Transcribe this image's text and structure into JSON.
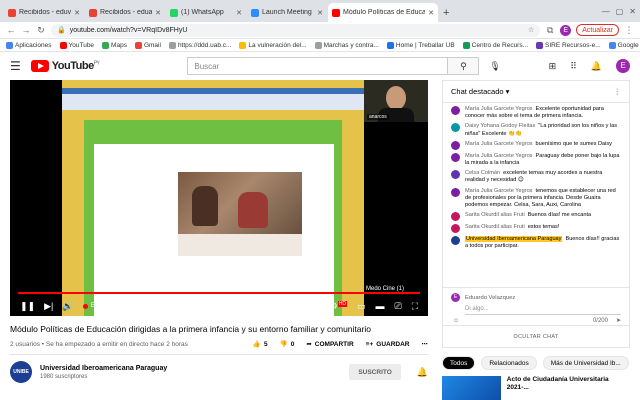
{
  "browser": {
    "tabs": [
      {
        "label": "Recibidos - eduvelrom@gmail...",
        "color": "#ea4335"
      },
      {
        "label": "Recibidos - eduardo.velazque...",
        "color": "#ea4335"
      },
      {
        "label": "(1) WhatsApp",
        "color": "#25d366"
      },
      {
        "label": "Launch Meeting - Zoom",
        "color": "#2d8cff"
      },
      {
        "label": "Módulo Políticas de Educació",
        "color": "#ff0000",
        "active": true
      }
    ],
    "url": "youtube.com/watch?v=VRqIDv8FHyU",
    "user_initial": "E",
    "update_label": "Actualizar",
    "bookmarks": [
      {
        "label": "Aplicaciones",
        "color": "#4285f4"
      },
      {
        "label": "YouTube",
        "color": "#ff0000"
      },
      {
        "label": "Maps",
        "color": "#34a853"
      },
      {
        "label": "Gmail",
        "color": "#ea4335"
      },
      {
        "label": "https://ddd.uab.c...",
        "color": "#9e9e9e"
      },
      {
        "label": "La vulneración del...",
        "color": "#fbbc05"
      },
      {
        "label": "Marchas y contra...",
        "color": "#9e9e9e"
      },
      {
        "label": "Home | Treballar UB",
        "color": "#1a73e8"
      },
      {
        "label": "Centro de Recurs...",
        "color": "#0f9d58"
      },
      {
        "label": "SIRE Recursos-e...",
        "color": "#673ab7"
      },
      {
        "label": "Google Académico",
        "color": "#4285f4"
      }
    ]
  },
  "yt": {
    "logo_text": "YouTube",
    "logo_region": "PY",
    "search_placeholder": "Buscar",
    "user_initial": "E"
  },
  "player": {
    "speaker_name": "anarcos",
    "overlay_label": "Medo Cine (1)",
    "live_label": "EN DIRECTO",
    "hd_badge": "HD"
  },
  "video": {
    "title": "Módulo Políticas de Educación dirigidas a la primera infancia y su entorno familiar y comunitario",
    "meta": "2 usuarios • Se ha empezado a emitir en directo hace 2 horas",
    "likes": "5",
    "dislikes": "0",
    "share_label": "COMPARTIR",
    "save_label": "GUARDAR"
  },
  "channel": {
    "logo_text": "UNIBE",
    "name": "Universidad Iberoamericana Paraguay",
    "subs": "1980 suscriptores",
    "subscribe_label": "SUSCRITO"
  },
  "chat": {
    "header": "Chat destacado",
    "messages": [
      {
        "author": "María Julia Garcete Yegros",
        "text": "Excelente oportunidad para conocer más sobre el tema de primera infancia.",
        "color": "#7b1fa2"
      },
      {
        "author": "Daisy Yohana Godoy Fleitas",
        "text": "\"La prioridad son los niños y las niñas\" Excelente 👏👏",
        "color": "#0097a7"
      },
      {
        "author": "María Julia Garcete Yegros",
        "text": "buenísimo que te sumes Daisy",
        "color": "#7b1fa2"
      },
      {
        "author": "María Julia Garcete Yegros",
        "text": "Paraguay debe poner bajo la lupa la mirada a la infancia",
        "color": "#7b1fa2"
      },
      {
        "author": "Celsa Colmán",
        "text": "excelente temas muy acordes a nuestra realidad y necesidad 😊",
        "color": "#5e35b1"
      },
      {
        "author": "María Julia Garcete Yegros",
        "text": "tenemos que establecer una red de profesionales por la primera infancia. Desde Guaira podemos empezar. Celsa, Sara, Auxi, Carolina",
        "color": "#7b1fa2"
      },
      {
        "author": "Sarita Okurdil alias Fruti",
        "text": "Buenos días! me encanta",
        "color": "#c2185b"
      },
      {
        "author": "Sarita Okurdil alias Fruti",
        "text": "estos temas!",
        "color": "#c2185b"
      },
      {
        "author": "Universidad Iberoamericana Paraguay",
        "text": "Buenos días!! gracias a todos por participar.",
        "color": "#1c3f94",
        "highlight": true
      }
    ],
    "input_user": "Eduardo Velazquez",
    "input_placeholder": "Di algo...",
    "counter": "0/200",
    "hide_label": "OCULTAR CHAT"
  },
  "chips": [
    {
      "label": "Todos",
      "active": true
    },
    {
      "label": "Relacionados"
    },
    {
      "label": "Más de Universidad Ib..."
    }
  ],
  "recommendation": {
    "title": "Acto de Ciudadanía Universitaria 2021-..."
  }
}
